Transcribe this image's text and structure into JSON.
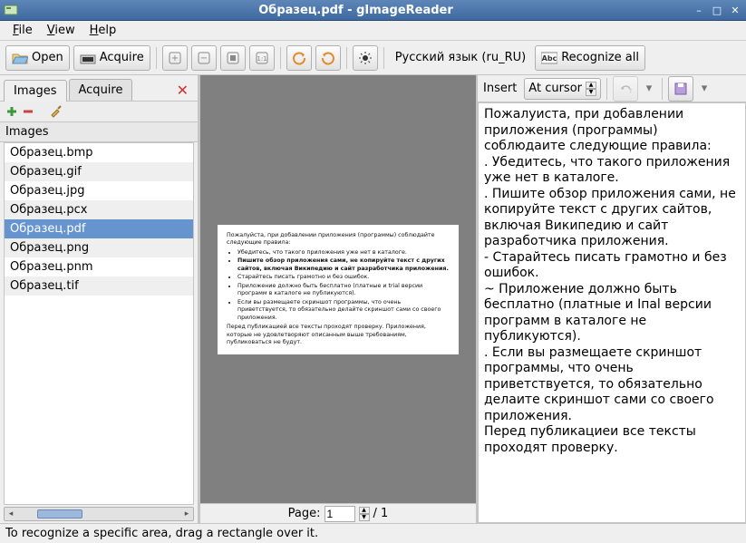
{
  "window": {
    "title": "Образец.pdf - gImageReader"
  },
  "menu": {
    "file": "File",
    "view": "View",
    "help": "Help"
  },
  "toolbar": {
    "open": "Open",
    "acquire": "Acquire",
    "language": "Русский язык (ru_RU)",
    "recognize_all": "Recognize all"
  },
  "sidebar": {
    "tabs": {
      "images": "Images",
      "acquire": "Acquire"
    },
    "header": "Images",
    "files": [
      "Образец.bmp",
      "Образец.gif",
      "Образец.jpg",
      "Образец.pcx",
      "Образец.pdf",
      "Образец.png",
      "Образец.pnm",
      "Образец.tif"
    ],
    "selected_index": 4
  },
  "page_preview": {
    "intro": "Пожалуйста, при добавлении приложения (программы) соблюдайте следующие правила:",
    "bullets": [
      "Убедитесь, что такого приложения уже нет в каталоге.",
      "Пишите обзор приложения сами, не копируйте текст с других сайтов, включая Википедию и сайт разработчика приложения.",
      "Старайтесь писать грамотно и без ошибок.",
      "Приложение должно быть бесплатно (платные и trial версии программ в каталоге не публикуются).",
      "Если вы размещаете скриншот программы, что очень приветствуется, то обязательно делайте скриншот сами со своего приложения."
    ],
    "outro": "Перед публикацией все тексты проходят проверку. Приложения, которые не удовлетворяют описанным выше требованиям, публиковаться не будут.",
    "bold_index": 1
  },
  "pager": {
    "label": "Page:",
    "current": "1",
    "total": "/ 1"
  },
  "output": {
    "insert_label": "Insert",
    "insert_mode": "At cursor",
    "text": "Пожалуиста, при добавлении приложения (программы) соблюдаите следующие правила:\n. Убедитесь, что такого приложения уже нет в каталоге.\n. Пишите обзор приложения сами, не копируйте текст с других сайтов, включая Википедию и сайт разработчика приложения.\n- Старайтесь писать грамотно и без ошибок.\n~ Приложение должно быть бесплатно (платные и Iпаl версии программ в каталоге не публикуются).\n. Если вы размещаете скриншот программы, что очень приветствуется, то обязательно делаите скриншот сами со своего приложения.\nПеред публикациеи все тексты проходят проверку."
  },
  "status": "To recognize a specific area, drag a rectangle over it."
}
